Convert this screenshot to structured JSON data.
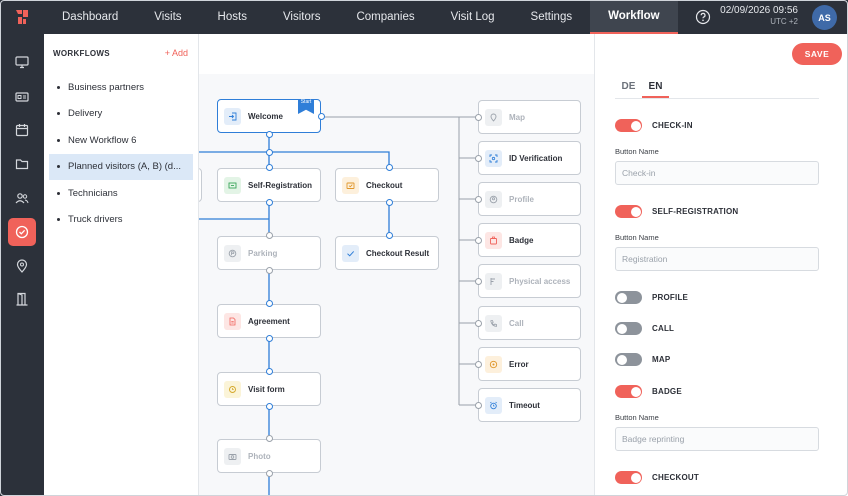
{
  "nav": {
    "items": [
      "Dashboard",
      "Visits",
      "Hosts",
      "Visitors",
      "Companies",
      "Visit Log",
      "Settings",
      "Workflow"
    ],
    "active": "Workflow"
  },
  "header": {
    "date": "02/09/2026 09:56",
    "timezone": "UTC +2",
    "user_initials": "AS"
  },
  "rail": {
    "icons": [
      "monitor-icon",
      "id-card-icon",
      "calendar-icon",
      "folder-icon",
      "users-icon",
      "check-circle-icon",
      "location-pin-icon",
      "door-icon"
    ],
    "active": "check-circle-icon"
  },
  "workflows": {
    "title": "WORKFLOWS",
    "add_label": "+ Add",
    "items": [
      "Business partners",
      "Delivery",
      "New Workflow 6",
      "Planned visitors (A, B) (d...",
      "Technicians",
      "Truck drivers"
    ],
    "active_index": 3
  },
  "nodes": {
    "welcome": "Welcome",
    "start_badge": "Start",
    "self_registration": "Self-Registration",
    "checkout": "Checkout",
    "parking": "Parking",
    "checkout_result": "Checkout Result",
    "agreement": "Agreement",
    "visit_form": "Visit form",
    "photo": "Photo",
    "map": "Map",
    "id_verification": "ID Verification",
    "profile": "Profile",
    "badge": "Badge",
    "physical_access": "Physical access",
    "call": "Call",
    "error": "Error",
    "timeout": "Timeout"
  },
  "settings": {
    "save_label": "SAVE",
    "tabs": [
      "DE",
      "EN"
    ],
    "active_tab": "EN",
    "button_name_label": "Button Name",
    "toggles": [
      {
        "label": "CHECK-IN",
        "on": true,
        "button_name": "Check-in"
      },
      {
        "label": "SELF-REGISTRATION",
        "on": true,
        "button_name": "Registration"
      },
      {
        "label": "PROFILE",
        "on": false
      },
      {
        "label": "CALL",
        "on": false
      },
      {
        "label": "MAP",
        "on": false
      },
      {
        "label": "BADGE",
        "on": true,
        "button_name": "Badge reprinting"
      },
      {
        "label": "CHECKOUT",
        "on": true
      }
    ]
  },
  "colors": {
    "nav_bg": "#2c313a",
    "accent": "#f0625a",
    "link_blue": "#2f7ed8",
    "selection_bg": "#dbe8f7"
  }
}
